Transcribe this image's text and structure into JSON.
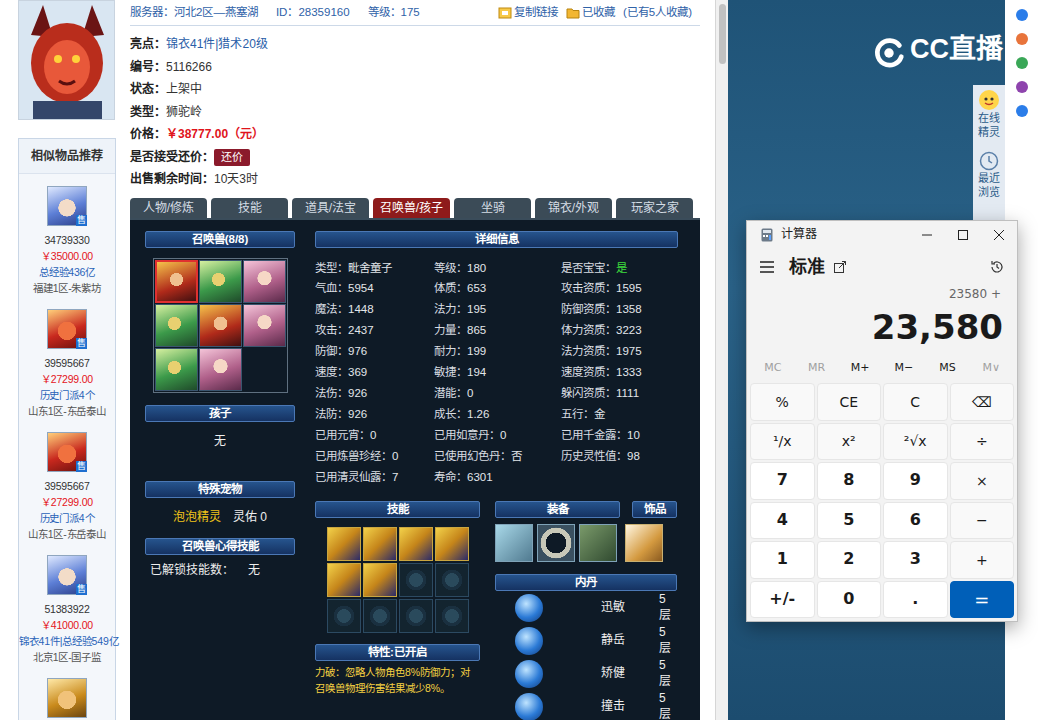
{
  "header": {
    "server_label": "服务器：",
    "server": "河北2区—燕塞湖",
    "id_label": "ID：",
    "id": "28359160",
    "level_label": "等级：",
    "level": "175",
    "copy_link": "复制链接",
    "favorite": "已收藏",
    "favorite_count": "(已有5人收藏)"
  },
  "info": [
    {
      "label": "亮点：",
      "value": "锦衣41件|猎术20级",
      "kind": "link"
    },
    {
      "label": "编号：",
      "value": "5116266",
      "kind": "plain"
    },
    {
      "label": "状态：",
      "value": "上架中",
      "kind": "plain"
    },
    {
      "label": "类型：",
      "value": "狮驼岭",
      "kind": "plain"
    },
    {
      "label": "价格：",
      "value": "￥38777.00（元）",
      "kind": "price"
    },
    {
      "label": "是否接受还价：",
      "value": "还价",
      "kind": "button"
    },
    {
      "label": "出售剩余时间：",
      "value": "10天3时",
      "kind": "plain"
    }
  ],
  "similar": {
    "title": "相似物品推荐",
    "items": [
      {
        "id": "34739330",
        "price": "￥35000.00",
        "note": "总经验436亿",
        "server": "福建1区-朱紫坊",
        "badge": "售"
      },
      {
        "id": "39595667",
        "price": "￥27299.00",
        "note": "历史门派4个",
        "server": "山东1区-东岳泰山",
        "badge": "售"
      },
      {
        "id": "39595667",
        "price": "￥27299.00",
        "note": "历史门派4个",
        "server": "山东1区-东岳泰山",
        "badge": "售"
      },
      {
        "id": "51383922",
        "price": "￥41000.00",
        "note": "锦衣41件|总经验549亿",
        "server": "北京1区-国子监",
        "badge": "售"
      }
    ]
  },
  "tabs": [
    {
      "label": "人物/修炼",
      "selected": false
    },
    {
      "label": "技能",
      "selected": false
    },
    {
      "label": "道具/法宝",
      "selected": false
    },
    {
      "label": "召唤兽/孩子",
      "selected": true
    },
    {
      "label": "坐骑",
      "selected": false
    },
    {
      "label": "锦衣/外观",
      "selected": false
    },
    {
      "label": "玩家之家",
      "selected": false
    }
  ],
  "pets": {
    "title": "召唤兽(8/8)",
    "items": [
      {
        "selected": true
      },
      {
        "selected": false
      },
      {
        "selected": false
      },
      {
        "selected": false
      },
      {
        "selected": false
      },
      {
        "selected": false
      },
      {
        "selected": false
      },
      {
        "selected": false
      }
    ]
  },
  "child": {
    "title": "孩子",
    "value": "无"
  },
  "special": {
    "title": "特殊宠物",
    "name": "泡泡精灵",
    "value": "灵佑  0"
  },
  "insight": {
    "title": "召唤兽心得技能",
    "label": "已解锁技能数：",
    "value": "无"
  },
  "details": {
    "title": "详细信息",
    "rows": [
      [
        {
          "label": "类型：",
          "value": "毗舍童子"
        },
        {
          "label": "等级：",
          "value": "180"
        },
        {
          "label": "是否宝宝：",
          "value": "是",
          "color": "#3ddc3d"
        }
      ],
      [
        {
          "label": "气血：",
          "value": "5954"
        },
        {
          "label": "体质：",
          "value": "653"
        },
        {
          "label": "攻击资质：",
          "value": "1595"
        }
      ],
      [
        {
          "label": "魔法：",
          "value": "1448"
        },
        {
          "label": "法力：",
          "value": "195"
        },
        {
          "label": "防御资质：",
          "value": "1358"
        }
      ],
      [
        {
          "label": "攻击：",
          "value": "2437"
        },
        {
          "label": "力量：",
          "value": "865"
        },
        {
          "label": "体力资质：",
          "value": "3223"
        }
      ],
      [
        {
          "label": "防御：",
          "value": "976"
        },
        {
          "label": "耐力：",
          "value": "199"
        },
        {
          "label": "法力资质：",
          "value": "1975"
        }
      ],
      [
        {
          "label": "速度：",
          "value": "369"
        },
        {
          "label": "敏捷：",
          "value": "194"
        },
        {
          "label": "速度资质：",
          "value": "1333"
        }
      ],
      [
        {
          "label": "法伤：",
          "value": "926"
        },
        {
          "label": "潜能：",
          "value": "0"
        },
        {
          "label": "躲闪资质：",
          "value": "1111"
        }
      ],
      [
        {
          "label": "法防：",
          "value": "926"
        },
        {
          "label": "成长：",
          "value": "1.26"
        },
        {
          "label": "五行：",
          "value": "金"
        }
      ],
      [
        {
          "label": "已用元宵：",
          "value": "0"
        },
        {
          "label": "已用如意丹：",
          "value": "0"
        },
        {
          "label": "已用千金露：",
          "value": "10"
        }
      ],
      [
        {
          "label": "已用炼兽珍经：",
          "value": "0"
        },
        {
          "label": "已使用幻色丹：",
          "value": "否"
        },
        {
          "label": "历史灵性值：",
          "value": "98"
        }
      ],
      [
        {
          "label": "已用清灵仙露：",
          "value": "7"
        },
        {
          "label": "寿命：",
          "value": "6301"
        }
      ]
    ]
  },
  "skills": {
    "title": "技能",
    "slots": [
      {
        "filled": true
      },
      {
        "filled": true
      },
      {
        "filled": true
      },
      {
        "filled": true
      },
      {
        "filled": true
      },
      {
        "filled": true
      },
      {
        "filled": false
      },
      {
        "filled": false
      },
      {
        "filled": false
      },
      {
        "filled": false
      },
      {
        "filled": false
      },
      {
        "filled": false
      }
    ]
  },
  "trait": {
    "title": "特性:已开启",
    "text": "力破：忽略人物角色8%防御力；对召唤兽物理伤害结果减少8%。"
  },
  "equipment": {
    "title": "装备",
    "accessory_title": "饰品"
  },
  "neidan": {
    "title": "内丹",
    "items": [
      {
        "name": "迅敏",
        "layer": "5层"
      },
      {
        "name": "静岳",
        "layer": "5层"
      },
      {
        "name": "矫健",
        "layer": "5层"
      },
      {
        "name": "撞击",
        "layer": "5层"
      }
    ]
  },
  "stream": {
    "logo": "CC直播",
    "side": [
      {
        "label": "在线精灵"
      },
      {
        "label": "最近浏览"
      }
    ]
  },
  "calculator": {
    "title": "计算器",
    "mode": "标准",
    "expression": "23580 +",
    "display": "23,580",
    "memory": [
      {
        "label": "MC",
        "disabled": true
      },
      {
        "label": "MR",
        "disabled": true
      },
      {
        "label": "M+",
        "disabled": false
      },
      {
        "label": "M−",
        "disabled": false
      },
      {
        "label": "MS",
        "disabled": false
      },
      {
        "label": "M∨",
        "disabled": true
      }
    ],
    "keys": [
      {
        "label": "%",
        "kind": "fn"
      },
      {
        "label": "CE",
        "kind": "fn"
      },
      {
        "label": "C",
        "kind": "fn"
      },
      {
        "label": "⌫",
        "kind": "fn"
      },
      {
        "label": "¹/x",
        "kind": "fn"
      },
      {
        "label": "x²",
        "kind": "fn"
      },
      {
        "label": "²√x",
        "kind": "fn"
      },
      {
        "label": "÷",
        "kind": "fn"
      },
      {
        "label": "7",
        "kind": "num"
      },
      {
        "label": "8",
        "kind": "num"
      },
      {
        "label": "9",
        "kind": "num"
      },
      {
        "label": "×",
        "kind": "fn"
      },
      {
        "label": "4",
        "kind": "num"
      },
      {
        "label": "5",
        "kind": "num"
      },
      {
        "label": "6",
        "kind": "num"
      },
      {
        "label": "−",
        "kind": "fn"
      },
      {
        "label": "1",
        "kind": "num"
      },
      {
        "label": "2",
        "kind": "num"
      },
      {
        "label": "3",
        "kind": "num"
      },
      {
        "label": "+",
        "kind": "fn"
      },
      {
        "label": "+/-",
        "kind": "num"
      },
      {
        "label": "0",
        "kind": "num"
      },
      {
        "label": ".",
        "kind": "num"
      },
      {
        "label": "=",
        "kind": "equals"
      }
    ]
  }
}
